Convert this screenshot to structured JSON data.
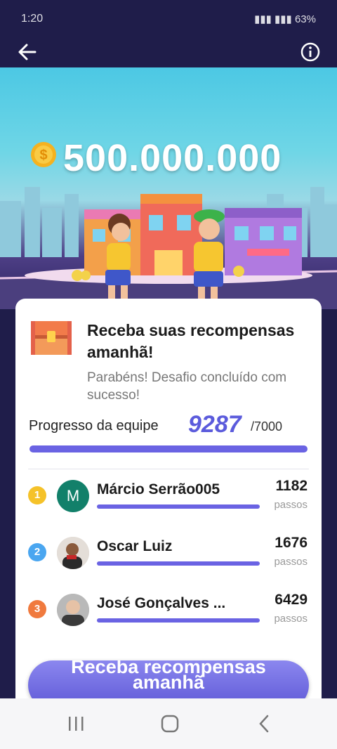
{
  "status_bar": {
    "time": "1:20",
    "battery": "63%"
  },
  "hero": {
    "reward_amount": "500.000.000"
  },
  "card": {
    "title": "Receba suas recompensas amanhã!",
    "subtitle": "Parabéns! Desafio concluído com sucesso!",
    "progress_label": "Progresso da equipe",
    "progress_value": "9287",
    "progress_target": "/7000",
    "progress_fraction": 1.0
  },
  "members": [
    {
      "rank": "1",
      "name": "Márcio Serrão005",
      "steps": "1182",
      "unit": "passos",
      "avatar_letter": "M",
      "rank_color": "#f5c229",
      "avatar_color": "#12806a"
    },
    {
      "rank": "2",
      "name": "Oscar Luiz",
      "steps": "1676",
      "unit": "passos",
      "rank_color": "#4aa6f0"
    },
    {
      "rank": "3",
      "name": "José Gonçalves ...",
      "steps": "6429",
      "unit": "passos",
      "rank_color": "#f07a3e"
    }
  ],
  "cta": {
    "label": "Receba recompensas amanhã"
  },
  "colors": {
    "accent": "#6a63e3",
    "background": "#1f1d4a"
  },
  "icons": {
    "back": "arrow-left-icon",
    "info": "info-icon",
    "coin": "coin-icon",
    "chest": "treasure-chest-icon"
  }
}
